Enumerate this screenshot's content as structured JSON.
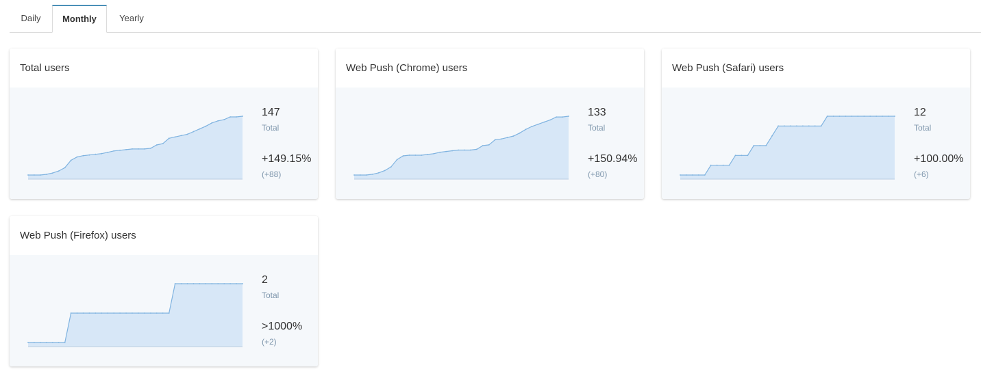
{
  "tabs": [
    {
      "label": "Daily",
      "active": false
    },
    {
      "label": "Monthly",
      "active": true
    },
    {
      "label": "Yearly",
      "active": false
    }
  ],
  "colors": {
    "line": "#7fb3e0",
    "fill": "#d7e7f7",
    "accent": "#4a90b8"
  },
  "cards": [
    {
      "title": "Total users",
      "total": "147",
      "total_label": "Total",
      "change": "+149.15%",
      "delta": "(+88)",
      "chart_data": {
        "type": "area",
        "values": [
          59,
          59,
          59,
          60,
          62,
          65,
          70,
          81,
          86,
          88,
          89,
          90,
          91,
          93,
          95,
          96,
          97,
          98,
          98,
          98,
          99,
          104,
          106,
          114,
          116,
          118,
          120,
          124,
          128,
          132,
          137,
          140,
          142,
          146,
          146,
          147
        ]
      }
    },
    {
      "title": "Web Push (Chrome) users",
      "total": "133",
      "total_label": "Total",
      "change": "+150.94%",
      "delta": "(+80)",
      "chart_data": {
        "type": "area",
        "values": [
          53,
          53,
          53,
          54,
          56,
          59,
          64,
          74,
          79,
          80,
          80,
          80,
          81,
          82,
          84,
          85,
          86,
          87,
          87,
          87,
          88,
          93,
          94,
          101,
          102,
          104,
          106,
          110,
          115,
          119,
          122,
          125,
          128,
          132,
          132,
          133
        ]
      }
    },
    {
      "title": "Web Push (Safari) users",
      "total": "12",
      "total_label": "Total",
      "change": "+100.00%",
      "delta": "(+6)",
      "chart_data": {
        "type": "area",
        "values": [
          6,
          6,
          6,
          6,
          6,
          7,
          7,
          7,
          7,
          8,
          8,
          8,
          9,
          9,
          9,
          10,
          11,
          11,
          11,
          11,
          11,
          11,
          11,
          11,
          12,
          12,
          12,
          12,
          12,
          12,
          12,
          12,
          12,
          12,
          12,
          12
        ]
      }
    },
    {
      "title": "Web Push (Firefox) users",
      "total": "2",
      "total_label": "Total",
      "change": ">1000%",
      "delta": "(+2)",
      "chart_data": {
        "type": "area",
        "values": [
          0,
          0,
          0,
          0,
          0,
          0,
          0,
          1,
          1,
          1,
          1,
          1,
          1,
          1,
          1,
          1,
          1,
          1,
          1,
          1,
          1,
          1,
          1,
          1,
          2,
          2,
          2,
          2,
          2,
          2,
          2,
          2,
          2,
          2,
          2,
          2
        ]
      }
    }
  ]
}
